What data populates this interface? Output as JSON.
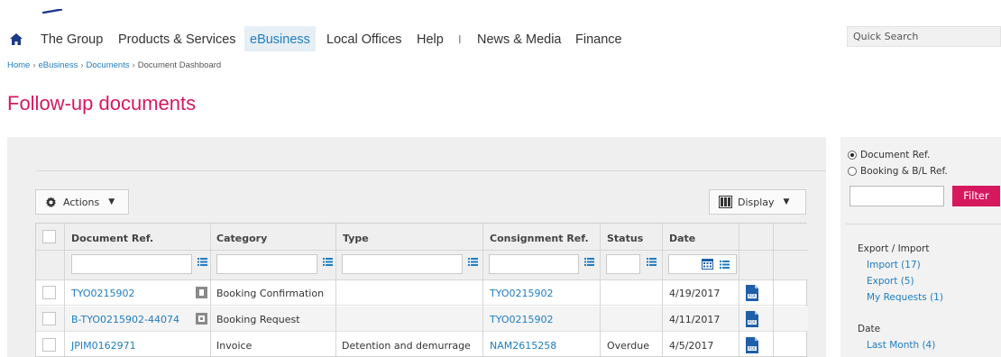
{
  "nav": {
    "items": [
      {
        "label": "The Group"
      },
      {
        "label": "Products & Services"
      },
      {
        "label": "eBusiness"
      },
      {
        "label": "Local Offices"
      },
      {
        "label": "Help"
      },
      {
        "label": "News & Media"
      },
      {
        "label": "Finance"
      }
    ],
    "separator": "I",
    "search_label": "Quick Search"
  },
  "breadcrumb": [
    "Home",
    "eBusiness",
    "Documents",
    "Document Dashboard"
  ],
  "page_title": "Follow-up documents",
  "toolbar": {
    "actions_label": "Actions",
    "display_label": "Display"
  },
  "table": {
    "columns": [
      "Document Ref.",
      "Category",
      "Type",
      "Consignment Ref.",
      "Status",
      "Date"
    ],
    "rows": [
      {
        "doc_ref": "TYO0215902",
        "category": "Booking Confirmation",
        "type": "",
        "consignment": "TYO0215902",
        "status": "",
        "date": "4/19/2017"
      },
      {
        "doc_ref": "B-TYO0215902-44074",
        "category": "Booking Request",
        "type": "",
        "consignment": "TYO0215902",
        "status": "",
        "date": "4/11/2017"
      },
      {
        "doc_ref": "JPIM0162971",
        "category": "Invoice",
        "type": "Detention and demurrage",
        "consignment": "NAM2615258",
        "status": "Overdue",
        "date": "4/5/2017"
      }
    ]
  },
  "sidebar": {
    "radio_options": [
      "Document Ref.",
      "Booking & B/L Ref."
    ],
    "selected_radio": "Document Ref.",
    "filter_label": "Filter",
    "export_heading": "Export / Import",
    "export_links": [
      "Import (17)",
      "Export (5)",
      "My Requests (1)"
    ],
    "date_heading": "Date",
    "date_links": [
      "Last Month (4)"
    ]
  },
  "colors": {
    "brand": "#d6195f",
    "link": "#1f7dc2"
  }
}
